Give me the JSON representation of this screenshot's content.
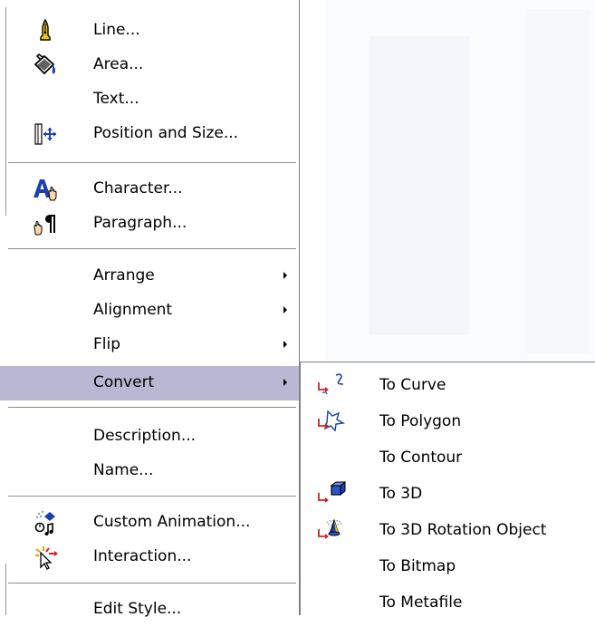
{
  "context_menu": {
    "items": [
      {
        "label": "Line...",
        "icon": "pen-icon"
      },
      {
        "label": "Area...",
        "icon": "paint-bucket-icon"
      },
      {
        "label": "Text..."
      },
      {
        "label": "Position and Size...",
        "icon": "position-size-icon"
      },
      {
        "label": "Character...",
        "icon": "character-icon"
      },
      {
        "label": "Paragraph...",
        "icon": "paragraph-icon"
      },
      {
        "label": "Arrange",
        "submenu": true
      },
      {
        "label": "Alignment",
        "submenu": true
      },
      {
        "label": "Flip",
        "submenu": true
      },
      {
        "label": "Convert",
        "submenu": true,
        "highlighted": true
      },
      {
        "label": "Description..."
      },
      {
        "label": "Name..."
      },
      {
        "label": "Custom Animation...",
        "icon": "custom-animation-icon"
      },
      {
        "label": "Interaction...",
        "icon": "interaction-icon"
      },
      {
        "label": "Edit Style..."
      }
    ]
  },
  "convert_submenu": {
    "items": [
      {
        "label": "To Curve",
        "icon": "to-curve-icon"
      },
      {
        "label": "To Polygon",
        "icon": "to-polygon-icon"
      },
      {
        "label": "To Contour"
      },
      {
        "label": "To 3D",
        "icon": "to-3d-icon"
      },
      {
        "label": "To 3D Rotation Object",
        "icon": "to-3d-rotation-icon"
      },
      {
        "label": "To Bitmap"
      },
      {
        "label": "To Metafile"
      }
    ]
  },
  "colors": {
    "highlight": "#b9b8d2",
    "separator": "#8c8c8c",
    "icon_blue": "#1a3fb0",
    "icon_red": "#d62020",
    "icon_yellow": "#f3c012"
  }
}
